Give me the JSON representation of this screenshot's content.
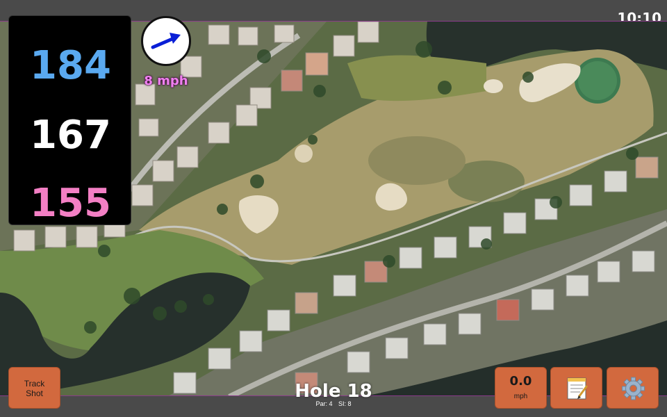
{
  "status_bar": {
    "time": "10:10"
  },
  "yardage": {
    "back": "184",
    "middle": "167",
    "front": "155"
  },
  "wind": {
    "speed_label": "8 mph"
  },
  "hole": {
    "title": "Hole 18",
    "par_label": "Par: 4",
    "si_label": "SI: 8"
  },
  "buttons": {
    "track_shot_line1": "Track",
    "track_shot_line2": "Shot",
    "speed_value": "0.0",
    "speed_unit": "mph",
    "notes_icon": "notepad-icon",
    "settings_icon": "gear-icon"
  },
  "colors": {
    "button_bg": "#d2693e",
    "back_yardage": "#5aa9f0",
    "middle_yardage": "#ffffff",
    "front_yardage": "#f37fc4",
    "wind_label": "#f080f0",
    "wind_arrow": "#0a1fd6"
  }
}
